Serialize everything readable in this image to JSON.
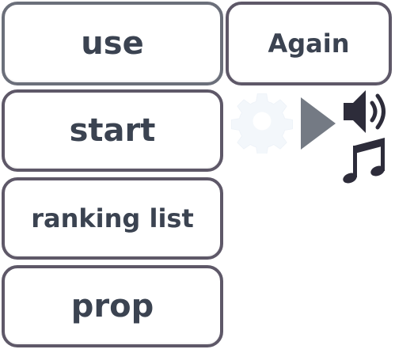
{
  "menu": {
    "use_label": "use",
    "start_label": "start",
    "ranking_label": "ranking list",
    "prop_label": "prop",
    "again_label": "Again"
  },
  "icons": {
    "settings": "gear-icon",
    "play": "play-icon",
    "sound": "speaker-icon",
    "music": "music-note-icon"
  },
  "colors": {
    "button_border": "#5e5868",
    "button_text": "#3b4351",
    "icon_dark": "#2d2c3a",
    "play_gray": "#747a84",
    "gear_faint": "#f4f8fc"
  }
}
